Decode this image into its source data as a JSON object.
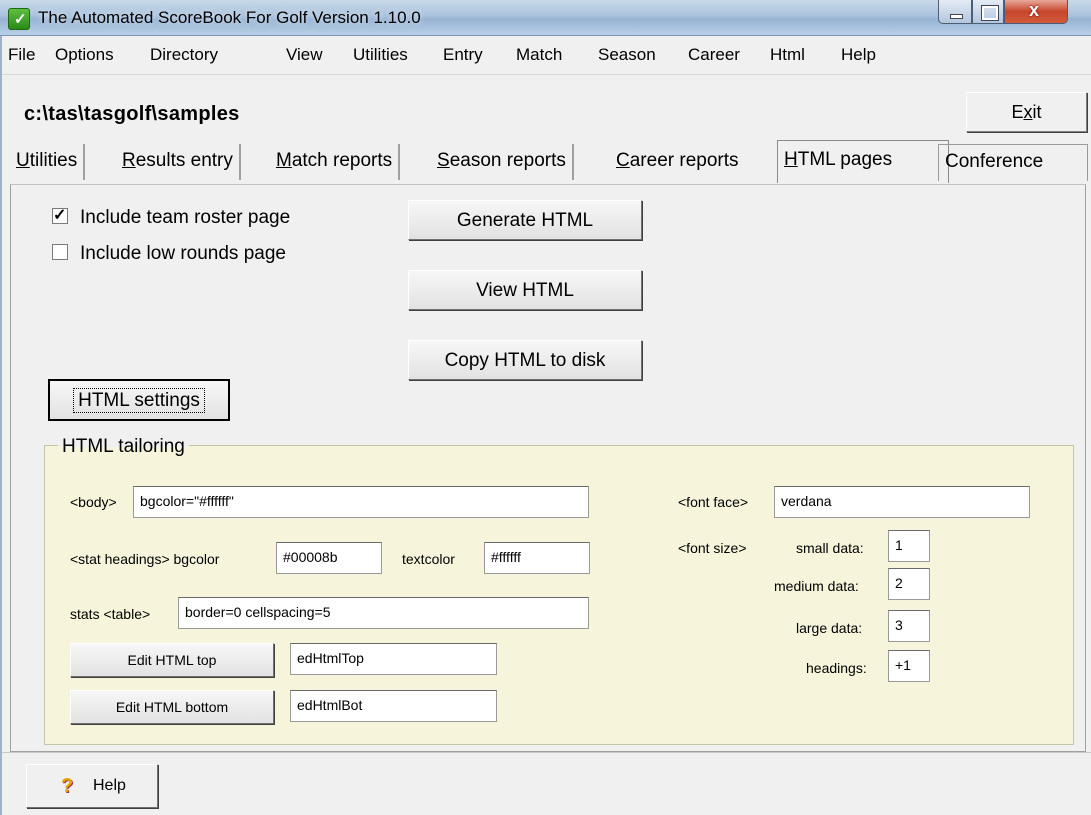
{
  "window": {
    "title": "The Automated ScoreBook For Golf  Version 1.10.0",
    "close_glyph": "x"
  },
  "menu": [
    "File",
    "Options",
    "Directory",
    "View",
    "Utilities",
    "Entry",
    "Match",
    "Season",
    "Career",
    "Html",
    "Help"
  ],
  "path": "c:\\tas\\tasgolf\\samples",
  "exit_button": {
    "prefix": "E",
    "mnemonic": "x",
    "suffix": "it"
  },
  "tabs": [
    {
      "mnemonic": "U",
      "rest": "tilities"
    },
    {
      "mnemonic": "R",
      "rest": "esults entry"
    },
    {
      "mnemonic": "M",
      "rest": "atch reports"
    },
    {
      "mnemonic": "S",
      "rest": "eason reports"
    },
    {
      "mnemonic": "C",
      "rest": "areer reports"
    },
    {
      "mnemonic": "H",
      "rest": "TML pages",
      "active": true
    },
    {
      "mnemonic": "",
      "rest": "Conference"
    }
  ],
  "options": {
    "include_roster": {
      "label": "Include team roster page",
      "checked": true
    },
    "include_low_rounds": {
      "label": "Include low rounds page",
      "checked": false
    }
  },
  "buttons": {
    "generate": "Generate HTML",
    "view": "View HTML",
    "copy": "Copy HTML to disk",
    "settings": "HTML settings"
  },
  "tailoring": {
    "legend": "HTML tailoring",
    "body_label": "<body>",
    "body_value": "bgcolor=\"#ffffff\"",
    "stat_headings_label": "<stat headings>  bgcolor",
    "stat_headings_bgcolor": "#00008b",
    "textcolor_label": "textcolor",
    "textcolor_value": "#ffffff",
    "stats_table_label": "stats <table>",
    "stats_table_value": "border=0 cellspacing=5",
    "edit_top_button": "Edit HTML top",
    "edit_top_value": "edHtmlTop",
    "edit_bottom_button": "Edit HTML bottom",
    "edit_bottom_value": "edHtmlBot",
    "font_face_label": "<font face>",
    "font_face_value": "verdana",
    "font_size_label": "<font size>",
    "small_label": "small data:",
    "small_value": "1",
    "medium_label": "medium data:",
    "medium_value": "2",
    "large_label": "large data:",
    "large_value": "3",
    "headings_label": "headings:",
    "headings_value": "+1"
  },
  "help_button": {
    "label": "Help",
    "icon": "question-icon"
  }
}
